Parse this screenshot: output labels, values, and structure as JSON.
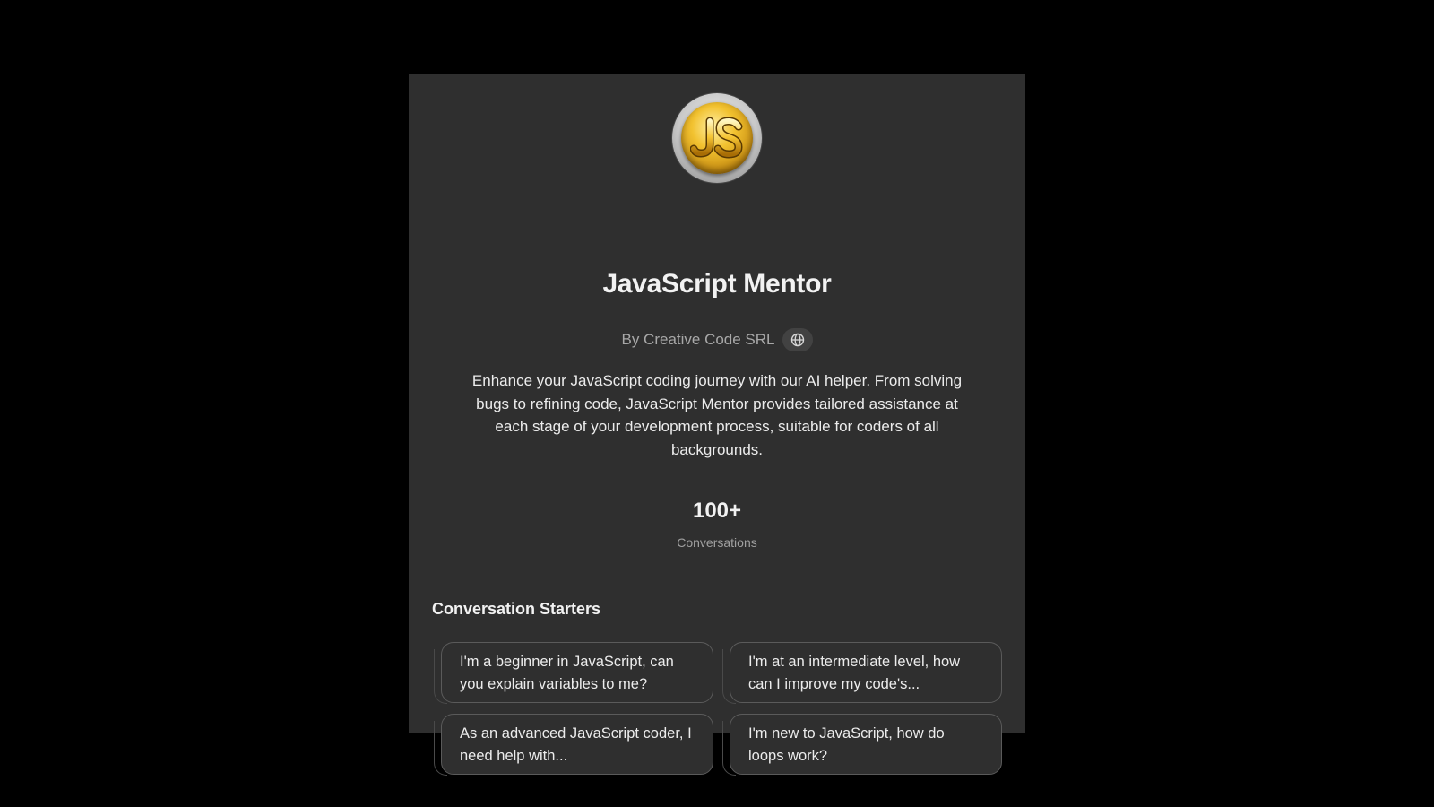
{
  "gpt": {
    "name": "JavaScript Mentor",
    "author": "By Creative Code SRL",
    "author_icon": "globe-icon",
    "avatar_icon": "js-coin-logo",
    "description": "Enhance your JavaScript coding journey with our AI helper. From solving bugs to refining code, JavaScript Mentor provides tailored assistance at each stage of your development process, suitable for coders of all backgrounds."
  },
  "stats": {
    "value": "100+",
    "label": "Conversations"
  },
  "starters": {
    "heading": "Conversation Starters",
    "items": [
      {
        "label": "I'm a beginner in JavaScript, can you explain variables to me?"
      },
      {
        "label": "I'm at an intermediate level, how can I improve my code's..."
      },
      {
        "label": "As an advanced JavaScript coder, I need help with..."
      },
      {
        "label": "I'm new to JavaScript, how do loops work?"
      }
    ]
  },
  "colors": {
    "page_background": "#000000",
    "panel_background": "#2f2f2f",
    "text_primary": "#ececec",
    "text_secondary": "#a8a8a8",
    "card_border": "#5a5a5a",
    "logo_gold": "#f2c230"
  }
}
